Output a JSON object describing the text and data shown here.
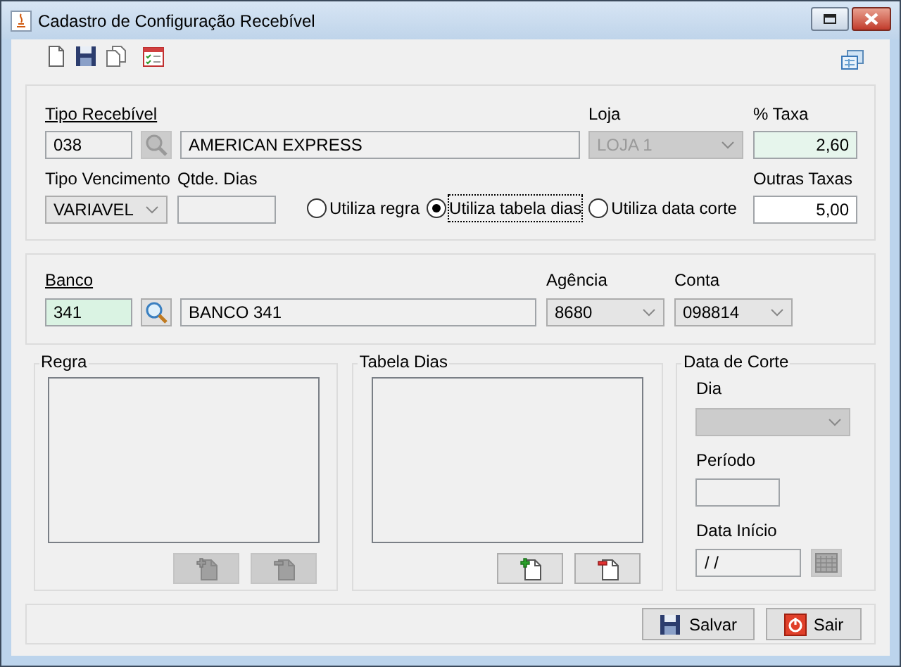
{
  "window": {
    "title": "Cadastro de Configuração Recebível"
  },
  "recebivel": {
    "tipo_label": "Tipo Recebível",
    "code": {
      "value": "038",
      "highlighted": false
    },
    "lookup_disabled": true,
    "name": "AMERICAN EXPRESS",
    "loja_label": "Loja",
    "loja": {
      "value": "LOJA 1",
      "disabled": true
    },
    "taxa_label": "% Taxa",
    "taxa": {
      "value": "2,60",
      "highlighted": true
    },
    "vencimento_label": "Tipo Vencimento",
    "vencimento": {
      "value": "VARIAVEL",
      "disabled": false
    },
    "dias_label": "Qtde. Dias",
    "radios": [
      {
        "label": "Utiliza regra",
        "selected": false
      },
      {
        "label": "Utiliza tabela dias",
        "selected": true
      },
      {
        "label": "Utiliza data corte",
        "selected": false
      }
    ],
    "outras_label": "Outras Taxas",
    "outras": {
      "value": "5,00",
      "highlighted": false
    }
  },
  "banco": {
    "label": "Banco",
    "code": {
      "value": "341",
      "highlighted": true
    },
    "lookup_disabled": false,
    "name": "BANCO 341",
    "agencia_label": "Agência",
    "agencia": {
      "value": "8680",
      "disabled": false
    },
    "conta_label": "Conta",
    "conta": {
      "value": "098814",
      "disabled": false
    }
  },
  "regra": {
    "title": "Regra",
    "buttons_disabled": true
  },
  "tabela_dias": {
    "title": "Tabela Dias",
    "buttons_disabled": false
  },
  "data_corte": {
    "title": "Data de Corte",
    "dia_label": "Dia",
    "dia_disabled": true,
    "periodo_label": "Período",
    "inicio_label": "Data Início",
    "inicio": "/ /",
    "calendar_disabled": true
  },
  "buttons": [
    {
      "label": "Salvar",
      "kind": "save"
    },
    {
      "label": "Sair",
      "kind": "exit"
    }
  ]
}
